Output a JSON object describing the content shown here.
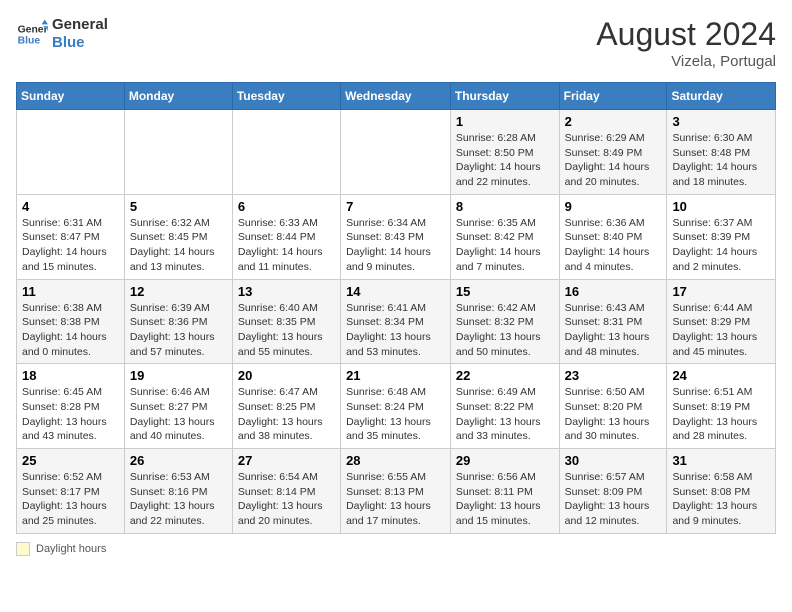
{
  "header": {
    "logo_line1": "General",
    "logo_line2": "Blue",
    "month_year": "August 2024",
    "location": "Vizela, Portugal"
  },
  "days_of_week": [
    "Sunday",
    "Monday",
    "Tuesday",
    "Wednesday",
    "Thursday",
    "Friday",
    "Saturday"
  ],
  "weeks": [
    [
      {
        "num": "",
        "info": ""
      },
      {
        "num": "",
        "info": ""
      },
      {
        "num": "",
        "info": ""
      },
      {
        "num": "",
        "info": ""
      },
      {
        "num": "1",
        "info": "Sunrise: 6:28 AM\nSunset: 8:50 PM\nDaylight: 14 hours and 22 minutes."
      },
      {
        "num": "2",
        "info": "Sunrise: 6:29 AM\nSunset: 8:49 PM\nDaylight: 14 hours and 20 minutes."
      },
      {
        "num": "3",
        "info": "Sunrise: 6:30 AM\nSunset: 8:48 PM\nDaylight: 14 hours and 18 minutes."
      }
    ],
    [
      {
        "num": "4",
        "info": "Sunrise: 6:31 AM\nSunset: 8:47 PM\nDaylight: 14 hours and 15 minutes."
      },
      {
        "num": "5",
        "info": "Sunrise: 6:32 AM\nSunset: 8:45 PM\nDaylight: 14 hours and 13 minutes."
      },
      {
        "num": "6",
        "info": "Sunrise: 6:33 AM\nSunset: 8:44 PM\nDaylight: 14 hours and 11 minutes."
      },
      {
        "num": "7",
        "info": "Sunrise: 6:34 AM\nSunset: 8:43 PM\nDaylight: 14 hours and 9 minutes."
      },
      {
        "num": "8",
        "info": "Sunrise: 6:35 AM\nSunset: 8:42 PM\nDaylight: 14 hours and 7 minutes."
      },
      {
        "num": "9",
        "info": "Sunrise: 6:36 AM\nSunset: 8:40 PM\nDaylight: 14 hours and 4 minutes."
      },
      {
        "num": "10",
        "info": "Sunrise: 6:37 AM\nSunset: 8:39 PM\nDaylight: 14 hours and 2 minutes."
      }
    ],
    [
      {
        "num": "11",
        "info": "Sunrise: 6:38 AM\nSunset: 8:38 PM\nDaylight: 14 hours and 0 minutes."
      },
      {
        "num": "12",
        "info": "Sunrise: 6:39 AM\nSunset: 8:36 PM\nDaylight: 13 hours and 57 minutes."
      },
      {
        "num": "13",
        "info": "Sunrise: 6:40 AM\nSunset: 8:35 PM\nDaylight: 13 hours and 55 minutes."
      },
      {
        "num": "14",
        "info": "Sunrise: 6:41 AM\nSunset: 8:34 PM\nDaylight: 13 hours and 53 minutes."
      },
      {
        "num": "15",
        "info": "Sunrise: 6:42 AM\nSunset: 8:32 PM\nDaylight: 13 hours and 50 minutes."
      },
      {
        "num": "16",
        "info": "Sunrise: 6:43 AM\nSunset: 8:31 PM\nDaylight: 13 hours and 48 minutes."
      },
      {
        "num": "17",
        "info": "Sunrise: 6:44 AM\nSunset: 8:29 PM\nDaylight: 13 hours and 45 minutes."
      }
    ],
    [
      {
        "num": "18",
        "info": "Sunrise: 6:45 AM\nSunset: 8:28 PM\nDaylight: 13 hours and 43 minutes."
      },
      {
        "num": "19",
        "info": "Sunrise: 6:46 AM\nSunset: 8:27 PM\nDaylight: 13 hours and 40 minutes."
      },
      {
        "num": "20",
        "info": "Sunrise: 6:47 AM\nSunset: 8:25 PM\nDaylight: 13 hours and 38 minutes."
      },
      {
        "num": "21",
        "info": "Sunrise: 6:48 AM\nSunset: 8:24 PM\nDaylight: 13 hours and 35 minutes."
      },
      {
        "num": "22",
        "info": "Sunrise: 6:49 AM\nSunset: 8:22 PM\nDaylight: 13 hours and 33 minutes."
      },
      {
        "num": "23",
        "info": "Sunrise: 6:50 AM\nSunset: 8:20 PM\nDaylight: 13 hours and 30 minutes."
      },
      {
        "num": "24",
        "info": "Sunrise: 6:51 AM\nSunset: 8:19 PM\nDaylight: 13 hours and 28 minutes."
      }
    ],
    [
      {
        "num": "25",
        "info": "Sunrise: 6:52 AM\nSunset: 8:17 PM\nDaylight: 13 hours and 25 minutes."
      },
      {
        "num": "26",
        "info": "Sunrise: 6:53 AM\nSunset: 8:16 PM\nDaylight: 13 hours and 22 minutes."
      },
      {
        "num": "27",
        "info": "Sunrise: 6:54 AM\nSunset: 8:14 PM\nDaylight: 13 hours and 20 minutes."
      },
      {
        "num": "28",
        "info": "Sunrise: 6:55 AM\nSunset: 8:13 PM\nDaylight: 13 hours and 17 minutes."
      },
      {
        "num": "29",
        "info": "Sunrise: 6:56 AM\nSunset: 8:11 PM\nDaylight: 13 hours and 15 minutes."
      },
      {
        "num": "30",
        "info": "Sunrise: 6:57 AM\nSunset: 8:09 PM\nDaylight: 13 hours and 12 minutes."
      },
      {
        "num": "31",
        "info": "Sunrise: 6:58 AM\nSunset: 8:08 PM\nDaylight: 13 hours and 9 minutes."
      }
    ]
  ],
  "footer": {
    "daylight_label": "Daylight hours"
  }
}
